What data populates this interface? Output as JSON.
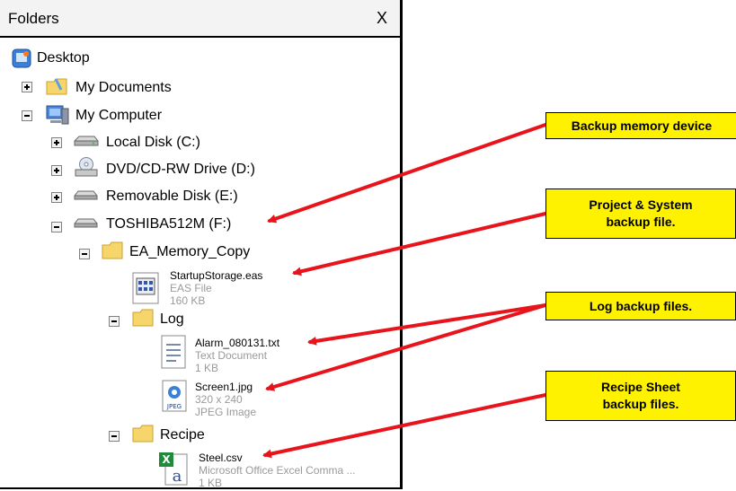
{
  "window": {
    "title": "Folders",
    "close_label": "X"
  },
  "tree": {
    "desktop": "Desktop",
    "my_documents": "My Documents",
    "my_computer": "My Computer",
    "local_disk": "Local Disk (C:)",
    "dvd_drive": "DVD/CD-RW Drive (D:)",
    "removable_disk": "Removable Disk (E:)",
    "toshiba": "TOSHIBA512M (F:)",
    "ea_memory_copy": "EA_Memory_Copy",
    "log": "Log",
    "recipe": "Recipe"
  },
  "files": {
    "startup": {
      "name": "StartupStorage.eas",
      "line2": "EAS File",
      "line3": "160 KB"
    },
    "alarm": {
      "name": "Alarm_080131.txt",
      "line2": "Text Document",
      "line3": "1 KB"
    },
    "screen": {
      "name": "Screen1.jpg",
      "line2": "320 x 240",
      "line3": "JPEG Image"
    },
    "steel": {
      "name": "Steel.csv",
      "line2": "Microsoft Office Excel Comma ...",
      "line3": "1 KB"
    }
  },
  "callouts": {
    "backup_device": "Backup memory device",
    "project_backup": "Project & System\nbackup file.",
    "log_backup": "Log backup files.",
    "recipe_backup": "Recipe Sheet\nbackup files."
  },
  "colors": {
    "callout_bg": "#fff200",
    "arrow": "#e8141c"
  }
}
